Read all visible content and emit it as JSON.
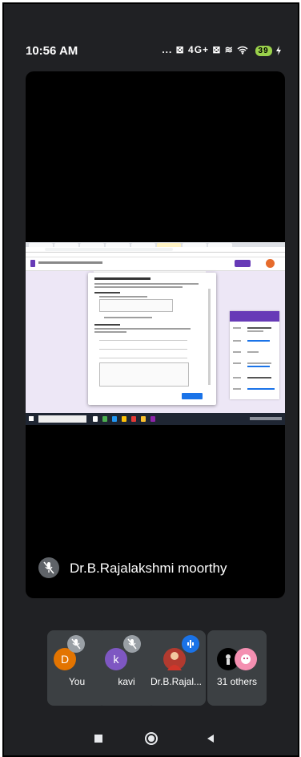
{
  "status_bar": {
    "time": "10:56 AM",
    "icons_text": "... ⊠ 4G+ ⊠ ≋",
    "battery": "39",
    "icons": [
      "notification-dots-icon",
      "volte-icon",
      "signal-icon",
      "wifi-icon",
      "battery-icon",
      "charging-icon"
    ]
  },
  "main_tile": {
    "presenter_name": "Dr.B.Rajalakshmi moorthy",
    "presenter_muted": true
  },
  "participants": [
    {
      "label": "You",
      "initial": "D",
      "avatar_color": "#e37400",
      "muted": true
    },
    {
      "label": "kavi",
      "initial": "k",
      "avatar_color": "#7e57c2",
      "muted": true
    },
    {
      "label": "Dr.B.Rajal...",
      "initial": "",
      "avatar_color": "#b23a2f",
      "speaking": true
    },
    {
      "label": "31 others",
      "initial": "",
      "avatar_color": "#f48fb1"
    }
  ],
  "colors": {
    "background": "#202124",
    "tile": "#3c4043",
    "accent": "#1a73e8",
    "forms_purple": "#673ab7"
  }
}
